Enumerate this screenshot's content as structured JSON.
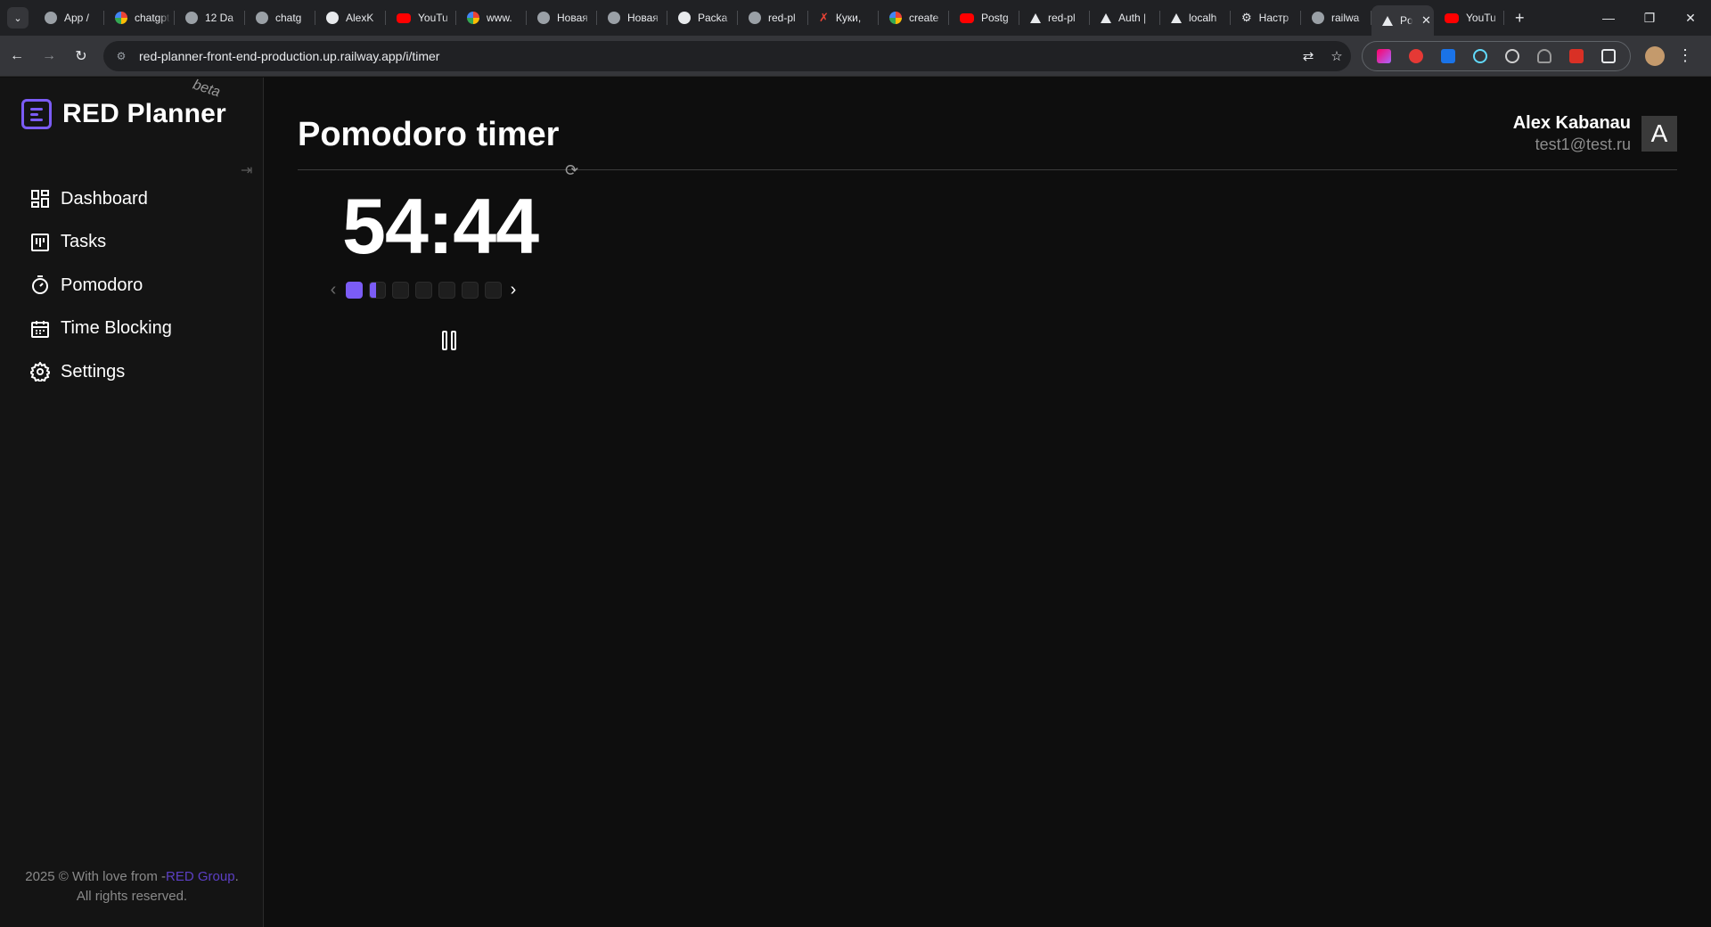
{
  "browser": {
    "tabs": [
      {
        "label": "App /",
        "icon": "globe-icon"
      },
      {
        "label": "chatgpt",
        "icon": "google-icon"
      },
      {
        "label": "12 Da",
        "icon": "globe-icon"
      },
      {
        "label": "chatg",
        "icon": "globe-icon"
      },
      {
        "label": "AlexK",
        "icon": "github-icon"
      },
      {
        "label": "YouTu",
        "icon": "youtube-icon"
      },
      {
        "label": "www.",
        "icon": "google-icon"
      },
      {
        "label": "Новая",
        "icon": "chrome-icon"
      },
      {
        "label": "Новая",
        "icon": "chrome-icon"
      },
      {
        "label": "Packa",
        "icon": "github-icon"
      },
      {
        "label": "red-pl",
        "icon": "globe-icon"
      },
      {
        "label": "Куки,",
        "icon": "red-icon"
      },
      {
        "label": "create",
        "icon": "google-icon"
      },
      {
        "label": "Postg",
        "icon": "youtube-icon"
      },
      {
        "label": "red-pl",
        "icon": "triangle-icon"
      },
      {
        "label": "Auth |",
        "icon": "triangle-icon"
      },
      {
        "label": "localh",
        "icon": "triangle-icon"
      },
      {
        "label": "Настр",
        "icon": "gear-icon"
      },
      {
        "label": "railwa",
        "icon": "globe-icon"
      },
      {
        "label": "Po",
        "icon": "triangle-icon",
        "active": true
      },
      {
        "label": "YouTu",
        "icon": "youtube-icon"
      }
    ],
    "url": "red-planner-front-end-production.up.railway.app/i/timer"
  },
  "app": {
    "name": "RED Planner",
    "badge": "beta",
    "nav": [
      {
        "label": "Dashboard",
        "icon": "dashboard-icon"
      },
      {
        "label": "Tasks",
        "icon": "kanban-icon"
      },
      {
        "label": "Pomodoro",
        "icon": "timer-icon"
      },
      {
        "label": "Time Blocking",
        "icon": "calendar-icon"
      },
      {
        "label": "Settings",
        "icon": "settings-icon"
      }
    ],
    "footer": {
      "prefix": "2025 © With love from -",
      "link": "RED Group",
      "suffix": ".",
      "line2": "All rights reserved."
    }
  },
  "header": {
    "title": "Pomodoro timer",
    "user_name": "Alex Kabanau",
    "user_email": "test1@test.ru",
    "avatar_letter": "A"
  },
  "timer": {
    "time": "54:44",
    "rounds_total": 7,
    "rounds_completed": 1,
    "current_round": 2,
    "current_round_progress": 0.4,
    "accent_color": "#7b5cf5"
  }
}
